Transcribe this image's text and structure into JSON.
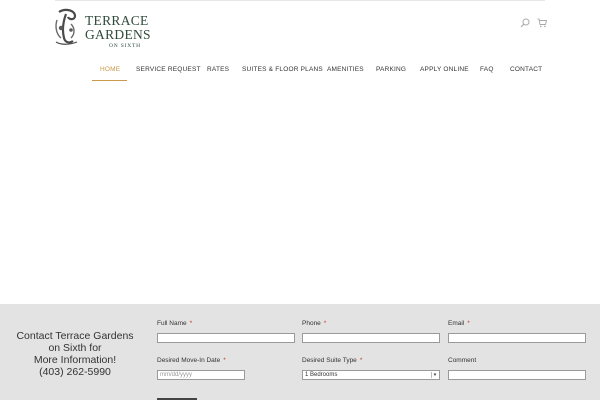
{
  "brand": {
    "line1": "TERRACE",
    "line2": "GARDENS",
    "line3": "ON SIXTH",
    "accent_color": "#c99a4a",
    "logo_color": "#2f4a3a"
  },
  "header": {
    "search_icon": "search-icon",
    "cart_icon": "cart-icon"
  },
  "nav": {
    "items": [
      {
        "label": "HOME"
      },
      {
        "label": "SERVICE REQUEST"
      },
      {
        "label": "RATES"
      },
      {
        "label": "SUITES & FLOOR PLANS"
      },
      {
        "label": "AMENITIES"
      },
      {
        "label": "PARKING"
      },
      {
        "label": "APPLY ONLINE"
      },
      {
        "label": "FAQ"
      },
      {
        "label": "CONTACT"
      }
    ]
  },
  "contact": {
    "line1": "Contact Terrace Gardens",
    "line2": "on Sixth for",
    "line3": "More Information!",
    "phone": "(403) 262-5990",
    "band_color": "#e3e3e3"
  },
  "form": {
    "full_name_label": "Full Name",
    "phone_label": "Phone",
    "email_label": "Email",
    "move_in_label": "Desired Move-In Date",
    "move_in_placeholder": "mm/dd/yyyy",
    "suite_type_label": "Desired Suite Type",
    "suite_type_value": "1 Bedrooms",
    "comment_label": "Comment",
    "required_mark": "*"
  }
}
